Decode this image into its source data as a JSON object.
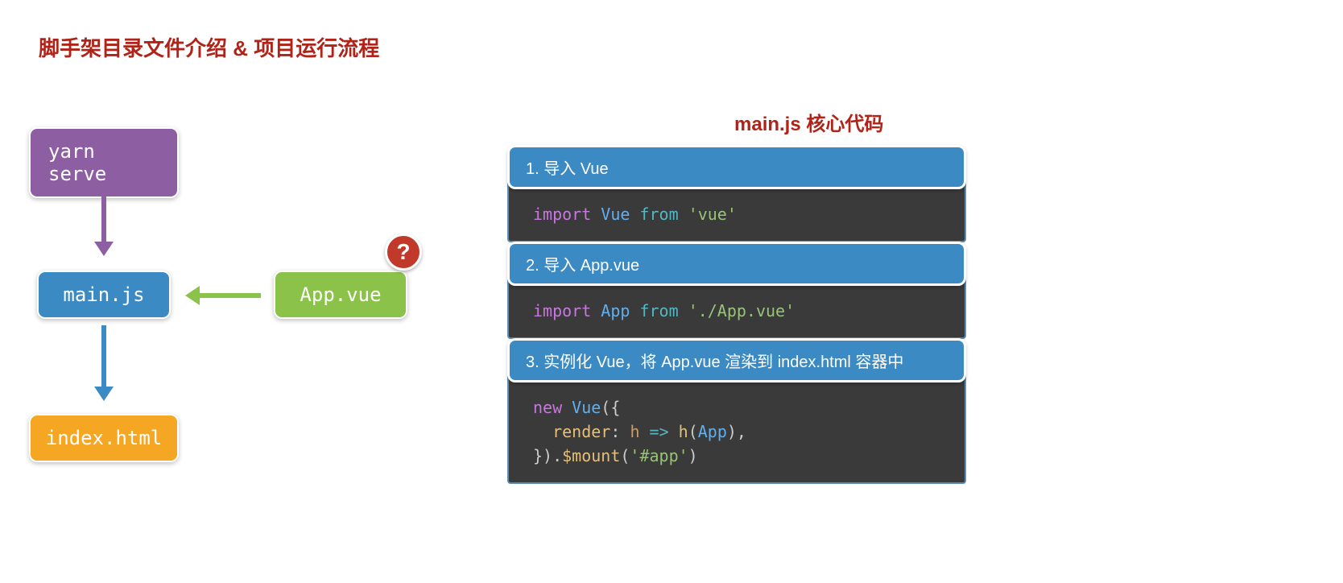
{
  "title": "脚手架目录文件介绍 & 项目运行流程",
  "flow": {
    "yarn_serve": "yarn serve",
    "main_js": "main.js",
    "app_vue": "App.vue",
    "index_html": "index.html",
    "question": "?"
  },
  "code_panel": {
    "title": "main.js 核心代码",
    "sections": [
      {
        "header": "1. 导入 Vue",
        "tokens": {
          "kw": "import",
          "cls": "Vue",
          "kw2": "from",
          "str": "'vue'"
        }
      },
      {
        "header": "2. 导入 App.vue",
        "tokens": {
          "kw": "import",
          "cls": "App",
          "kw2": "from",
          "str": "'./App.vue'"
        }
      },
      {
        "header": "3. 实例化 Vue，将 App.vue 渲染到 index.html 容器中",
        "tokens": {
          "kw_new": "new",
          "cls_vue": "Vue",
          "render": "render",
          "h1": "h",
          "arrow": "=>",
          "h2": "h",
          "app": "App",
          "mount": "$mount",
          "sel": "'#app'"
        }
      }
    ]
  }
}
